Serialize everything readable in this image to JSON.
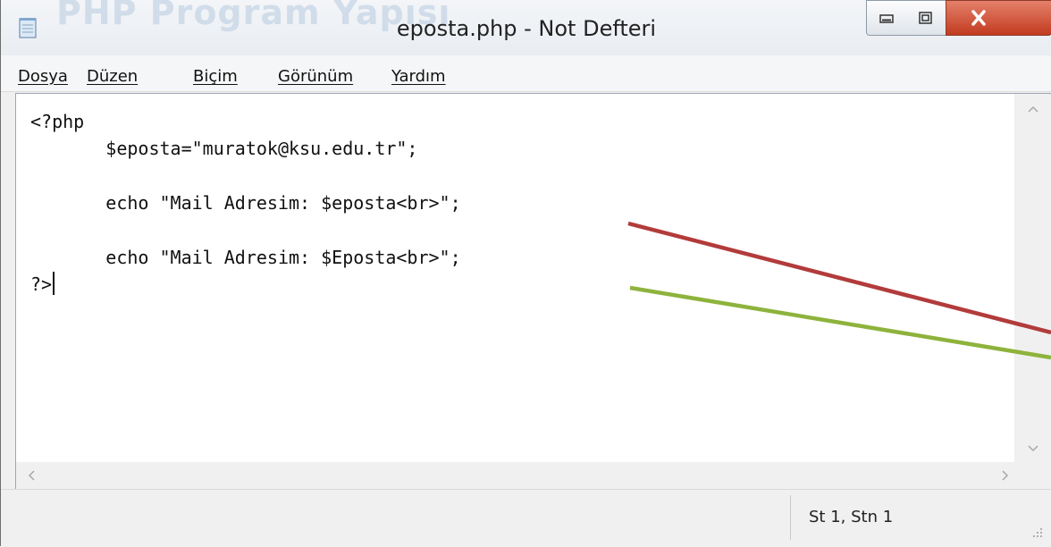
{
  "window": {
    "title": "eposta.php - Not Defteri",
    "background_title": "PHP Program Yapısı"
  },
  "menu": {
    "items": [
      {
        "label": "Dosya",
        "name": "menu-dosya"
      },
      {
        "label": "Düzen",
        "name": "menu-duzen"
      },
      {
        "label": "Biçim",
        "name": "menu-bicim"
      },
      {
        "label": "Görünüm",
        "name": "menu-gorunum"
      },
      {
        "label": "Yardım",
        "name": "menu-yardim"
      }
    ]
  },
  "editor": {
    "lines": [
      "<?php",
      "       $eposta=\"muratok@ksu.edu.tr\";",
      "",
      "       echo \"Mail Adresim: $eposta<br>\";",
      "",
      "       echo \"Mail Adresim: $Eposta<br>\";",
      "?>"
    ]
  },
  "statusbar": {
    "position": "St 1, Stn 1"
  },
  "colors": {
    "annotation_red": "#b23b3b",
    "annotation_green": "#8db33c",
    "close_button": "#c94a2e"
  },
  "icons": {
    "app": "notepad-icon",
    "minimize": "minimize-icon",
    "maximize": "maximize-icon",
    "close": "close-icon",
    "scroll_up": "chevron-up-icon",
    "scroll_down": "chevron-down-icon",
    "scroll_left": "chevron-left-icon",
    "scroll_right": "chevron-right-icon",
    "grip": "resize-grip-icon"
  }
}
